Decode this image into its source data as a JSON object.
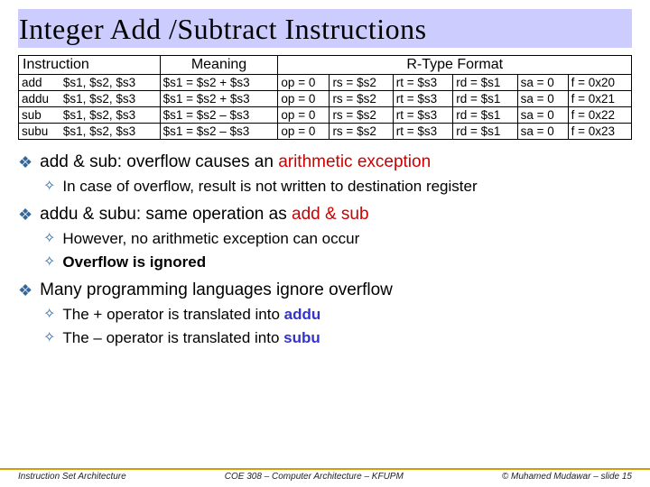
{
  "title": "Integer Add /Subtract Instructions",
  "table": {
    "headers": {
      "instruction": "Instruction",
      "meaning": "Meaning",
      "rtype": "R-Type Format"
    },
    "rows": [
      {
        "mn": "add",
        "args": "$s1, $s2, $s3",
        "meaning": "$s1 = $s2 + $s3",
        "op": "op = 0",
        "rs": "rs = $s2",
        "rt": "rt = $s3",
        "rd": "rd = $s1",
        "sa": "sa = 0",
        "f": "f = 0x20"
      },
      {
        "mn": "addu",
        "args": "$s1, $s2, $s3",
        "meaning": "$s1 = $s2 + $s3",
        "op": "op = 0",
        "rs": "rs = $s2",
        "rt": "rt = $s3",
        "rd": "rd = $s1",
        "sa": "sa = 0",
        "f": "f = 0x21"
      },
      {
        "mn": "sub",
        "args": "$s1, $s2, $s3",
        "meaning": "$s1 = $s2 – $s3",
        "op": "op = 0",
        "rs": "rs = $s2",
        "rt": "rt = $s3",
        "rd": "rd = $s1",
        "sa": "sa = 0",
        "f": "f = 0x22"
      },
      {
        "mn": "subu",
        "args": "$s1, $s2, $s3",
        "meaning": "$s1 = $s2 – $s3",
        "op": "op = 0",
        "rs": "rs = $s2",
        "rt": "rt = $s3",
        "rd": "rd = $s1",
        "sa": "sa = 0",
        "f": "f = 0x23"
      }
    ]
  },
  "bullets": {
    "b1_a": "add & sub: overflow causes an ",
    "b1_b": "arithmetic exception",
    "b1_1": "In case of overflow, result is not written to destination register",
    "b2_a": "addu & subu: same operation as ",
    "b2_b": "add & sub",
    "b2_1": "However, no arithmetic exception can occur",
    "b2_2": "Overflow is ignored",
    "b3": "Many programming languages ignore overflow",
    "b3_1a": "The + operator is translated into ",
    "b3_1b": "addu",
    "b3_2a": "The – operator is translated into ",
    "b3_2b": "subu"
  },
  "footer": {
    "left": "Instruction Set Architecture",
    "center": "COE 308 – Computer Architecture – KFUPM",
    "right": "© Muhamed Mudawar – slide 15"
  }
}
